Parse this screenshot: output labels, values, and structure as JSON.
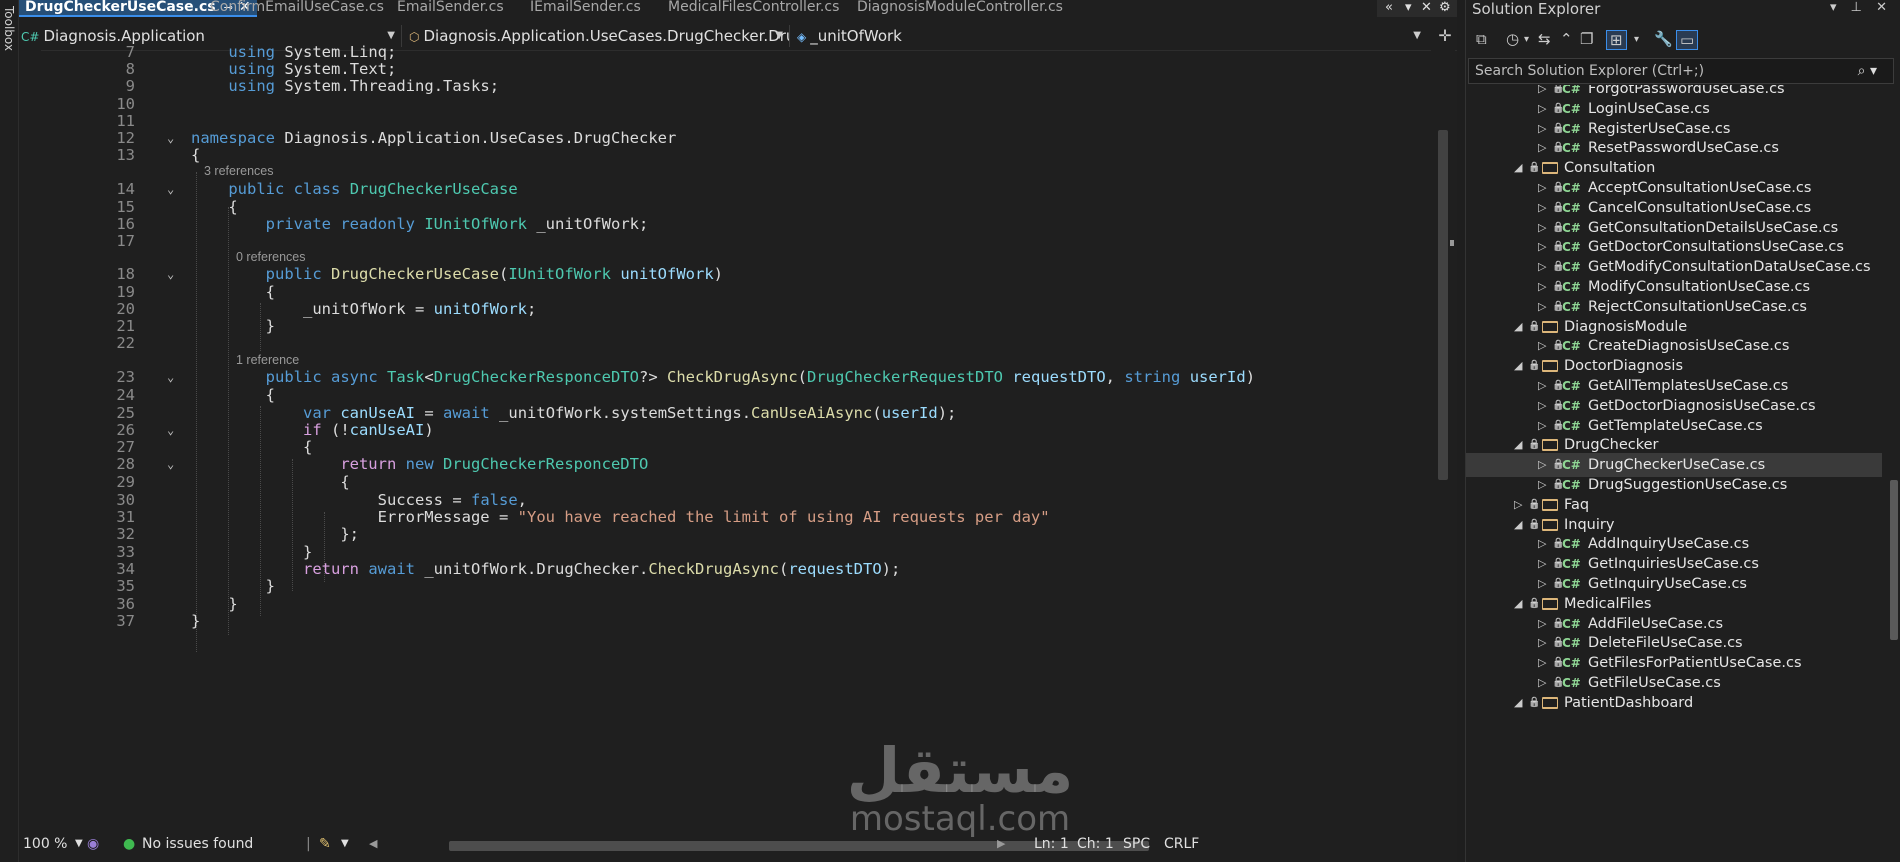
{
  "toolbox": {
    "label": "Toolbox"
  },
  "tabs": [
    {
      "label": "DrugCheckerUseCase.cs",
      "active": true
    },
    {
      "label": "ConfirmEmailUseCase.cs"
    },
    {
      "label": "EmailSender.cs"
    },
    {
      "label": "IEmailSender.cs"
    },
    {
      "label": "MedicalFilesController.cs"
    },
    {
      "label": "DiagnosisModuleController.cs"
    }
  ],
  "tab_controls": {
    "pin": "⊸",
    "close": "✕",
    "overflow": "«",
    "dropdown": "▾",
    "settings": "⚙"
  },
  "navbar": {
    "project": "Diagnosis.Application",
    "type": "Diagnosis.Application.UseCases.DrugChecker.DrugCheckerUseCa",
    "member": "_unitOfWork"
  },
  "code": {
    "lines": [
      {
        "n": "7",
        "t": "    using System.Linq;"
      },
      {
        "n": "8",
        "t": "    using System.Text;"
      },
      {
        "n": "9",
        "t": "    using System.Threading.Tasks;"
      },
      {
        "n": "10",
        "t": ""
      },
      {
        "n": "11",
        "t": ""
      },
      {
        "n": "12",
        "t": "namespace Diagnosis.Application.UseCases.DrugChecker"
      },
      {
        "n": "13",
        "t": "{"
      },
      {
        "n": "14",
        "t": "    public class DrugCheckerUseCase"
      },
      {
        "n": "15",
        "t": "    {"
      },
      {
        "n": "16",
        "t": "        private readonly IUnitOfWork _unitOfWork;"
      },
      {
        "n": "17",
        "t": ""
      },
      {
        "n": "18",
        "t": "        public DrugCheckerUseCase(IUnitOfWork unitOfWork)"
      },
      {
        "n": "19",
        "t": "        {"
      },
      {
        "n": "20",
        "t": "            _unitOfWork = unitOfWork;"
      },
      {
        "n": "21",
        "t": "        }"
      },
      {
        "n": "22",
        "t": ""
      },
      {
        "n": "23",
        "t": "        public async Task<DrugCheckerResponceDTO?> CheckDrugAsync(DrugCheckerRequestDTO requestDTO, string userId)"
      },
      {
        "n": "24",
        "t": "        {"
      },
      {
        "n": "25",
        "t": "            var canUseAI = await _unitOfWork.systemSettings.CanUseAiAsync(userId);"
      },
      {
        "n": "26",
        "t": "            if (!canUseAI)"
      },
      {
        "n": "27",
        "t": "            {"
      },
      {
        "n": "28",
        "t": "                return new DrugCheckerResponceDTO"
      },
      {
        "n": "29",
        "t": "                {"
      },
      {
        "n": "30",
        "t": "                    Success = false,"
      },
      {
        "n": "31",
        "t": "                    ErrorMessage = \"You have reached the limit of using AI requests per day\""
      },
      {
        "n": "32",
        "t": "                };"
      },
      {
        "n": "33",
        "t": "            }"
      },
      {
        "n": "34",
        "t": "            return await _unitOfWork.DrugChecker.CheckDrugAsync(requestDTO);"
      },
      {
        "n": "35",
        "t": "        }"
      },
      {
        "n": "36",
        "t": "    }"
      },
      {
        "n": "37",
        "t": "}"
      }
    ],
    "codelens": [
      "3 references",
      "0 references",
      "1 reference"
    ]
  },
  "status": {
    "zoom": "100 %",
    "issues": "No issues found",
    "line": "Ln: 1",
    "col": "Ch: 1",
    "whitespace": "SPC",
    "line_ending": "CRLF"
  },
  "solution_explorer": {
    "title": "Solution Explorer",
    "search_placeholder": "Search Solution Explorer (Ctrl+;)",
    "items": [
      {
        "label": "ForgotPasswordUseCase.cs",
        "kind": "file"
      },
      {
        "label": "LoginUseCase.cs",
        "kind": "file"
      },
      {
        "label": "RegisterUseCase.cs",
        "kind": "file"
      },
      {
        "label": "ResetPasswordUseCase.cs",
        "kind": "file"
      },
      {
        "label": "Consultation",
        "kind": "folder",
        "expanded": true
      },
      {
        "label": "AcceptConsultationUseCase.cs",
        "kind": "file"
      },
      {
        "label": "CancelConsultationUseCase.cs",
        "kind": "file"
      },
      {
        "label": "GetConsultationDetailsUseCase.cs",
        "kind": "file"
      },
      {
        "label": "GetDoctorConsultationsUseCase.cs",
        "kind": "file"
      },
      {
        "label": "GetModifyConsultationDataUseCase.cs",
        "kind": "file"
      },
      {
        "label": "ModifyConsultationUseCase.cs",
        "kind": "file"
      },
      {
        "label": "RejectConsultationUseCase.cs",
        "kind": "file"
      },
      {
        "label": "DiagnosisModule",
        "kind": "folder",
        "expanded": true
      },
      {
        "label": "CreateDiagnosisUseCase.cs",
        "kind": "file"
      },
      {
        "label": "DoctorDiagnosis",
        "kind": "folder",
        "expanded": true
      },
      {
        "label": "GetAllTemplatesUseCase.cs",
        "kind": "file"
      },
      {
        "label": "GetDoctorDiagnosisUseCase.cs",
        "kind": "file"
      },
      {
        "label": "GetTemplateUseCase.cs",
        "kind": "file"
      },
      {
        "label": "DrugChecker",
        "kind": "folder",
        "expanded": true
      },
      {
        "label": "DrugCheckerUseCase.cs",
        "kind": "file",
        "selected": true
      },
      {
        "label": "DrugSuggestionUseCase.cs",
        "kind": "file"
      },
      {
        "label": "Faq",
        "kind": "folder",
        "expanded": false
      },
      {
        "label": "Inquiry",
        "kind": "folder",
        "expanded": true
      },
      {
        "label": "AddInquiryUseCase.cs",
        "kind": "file"
      },
      {
        "label": "GetInquiriesUseCase.cs",
        "kind": "file"
      },
      {
        "label": "GetInquiryUseCase.cs",
        "kind": "file"
      },
      {
        "label": "MedicalFiles",
        "kind": "folder",
        "expanded": true
      },
      {
        "label": "AddFileUseCase.cs",
        "kind": "file"
      },
      {
        "label": "DeleteFileUseCase.cs",
        "kind": "file"
      },
      {
        "label": "GetFilesForPatientUseCase.cs",
        "kind": "file"
      },
      {
        "label": "GetFileUseCase.cs",
        "kind": "file"
      },
      {
        "label": "PatientDashboard",
        "kind": "folder",
        "expanded": true
      }
    ]
  },
  "watermark": {
    "arabic": "مستقل",
    "latin": "mostaql.com"
  }
}
